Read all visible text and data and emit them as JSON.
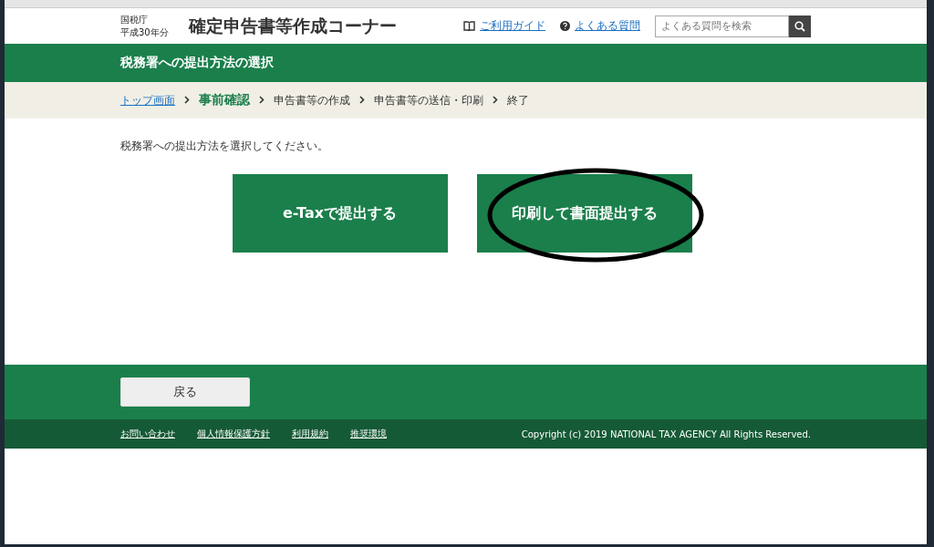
{
  "header": {
    "agency": "国税庁",
    "year": "平成30年分",
    "title": "確定申告書等作成コーナー",
    "links": [
      {
        "label": "ご利用ガイド",
        "kind": "guide"
      },
      {
        "label": "よくある質問",
        "kind": "faq"
      }
    ],
    "search": {
      "placeholder": "よくある質問を検索"
    }
  },
  "page_title": "税務署への提出方法の選択",
  "breadcrumb": [
    {
      "label": "トップ画面",
      "kind": "link"
    },
    {
      "label": "事前確認",
      "kind": "current"
    },
    {
      "label": "申告書等の作成",
      "kind": "plain"
    },
    {
      "label": "申告書等の送信・印刷",
      "kind": "plain"
    },
    {
      "label": "終了",
      "kind": "plain"
    }
  ],
  "instruction": "税務署への提出方法を選択してください。",
  "options": [
    {
      "label": "e-Taxで提出する",
      "circled": false
    },
    {
      "label": "印刷して書面提出する",
      "circled": true
    }
  ],
  "back_button": "戻る",
  "footer_links": [
    "お問い合わせ",
    "個人情報保護方針",
    "利用規約",
    "推奨環境"
  ],
  "copyright": "Copyright (c) 2019 NATIONAL TAX AGENCY All Rights Reserved."
}
